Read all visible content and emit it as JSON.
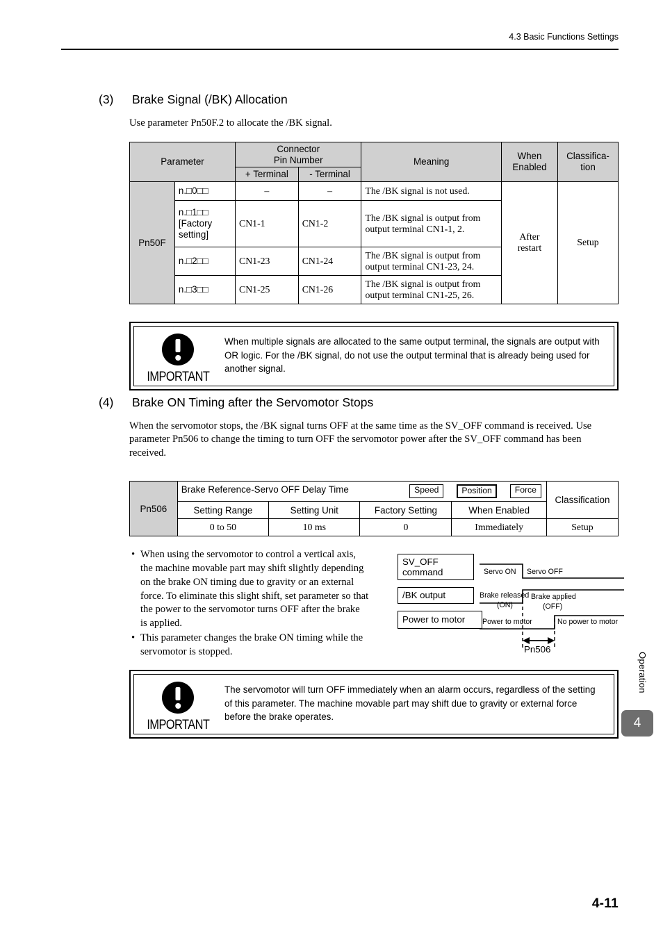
{
  "header": {
    "running_head": "4.3  Basic Functions Settings"
  },
  "section3": {
    "number": "(3)",
    "title": "Brake Signal (/BK) Allocation",
    "intro": "Use parameter Pn50F.2 to allocate the /BK signal."
  },
  "param_table": {
    "headers": {
      "parameter": "Parameter",
      "connector_pin_number": "Connector\nPin Number",
      "plus_terminal": "+ Terminal",
      "minus_terminal": "- Terminal",
      "meaning": "Meaning",
      "when_enabled": "When\nEnabled",
      "classification": "Classifica-\ntion"
    },
    "parameter_name": "Pn50F",
    "when_enabled_value": "After\nrestart",
    "classification_value": "Setup",
    "rows": [
      {
        "code": "n.□0□□",
        "note": "",
        "plus": "–",
        "minus": "–",
        "meaning": "The /BK signal is not used."
      },
      {
        "code": "n.□1□□",
        "note": "[Factory setting]",
        "plus": "CN1-1",
        "minus": "CN1-2",
        "meaning": "The /BK signal is output from output terminal CN1-1, 2."
      },
      {
        "code": "n.□2□□",
        "note": "",
        "plus": "CN1-23",
        "minus": "CN1-24",
        "meaning": "The /BK signal is output from output terminal CN1-23, 24."
      },
      {
        "code": "n.□3□□",
        "note": "",
        "plus": "CN1-25",
        "minus": "CN1-26",
        "meaning": "The /BK signal is output from output terminal CN1-25, 26."
      }
    ]
  },
  "important1": {
    "label": "IMPORTANT",
    "text": "When multiple signals are allocated to the same output terminal, the signals are output with OR logic. For the /BK signal, do not use the output terminal that is already being used for another signal."
  },
  "section4": {
    "number": "(4)",
    "title": "Brake ON Timing after the Servomotor Stops",
    "paragraph": "When the servomotor stops, the /BK signal turns OFF at the same time as the SV_OFF command is received. Use parameter Pn506 to change the timing to turn OFF the servomotor power after the SV_OFF command has been received."
  },
  "pn506_table": {
    "parameter_name": "Pn506",
    "title": "Brake Reference-Servo OFF Delay Time",
    "modes": [
      {
        "label": "Speed",
        "active": false
      },
      {
        "label": "Position",
        "active": true
      },
      {
        "label": "Force",
        "active": false
      }
    ],
    "classification_header": "Classification",
    "classification_value": "Setup",
    "columns": [
      "Setting Range",
      "Setting Unit",
      "Factory Setting",
      "When Enabled"
    ],
    "values": [
      "0 to 50",
      "10 ms",
      "0",
      "Immediately"
    ]
  },
  "bullets": [
    "When using the servomotor to control a vertical axis, the machine movable part may shift slightly depending on the brake ON timing due to gravity or an external force. To eliminate this slight shift, set parameter so that the power to the servomotor turns OFF after the brake is applied.",
    "This parameter changes the brake ON timing while the servomotor is stopped."
  ],
  "timing_diagram": {
    "signals": [
      {
        "name": "SV_OFF command",
        "left_state": "Servo ON",
        "right_state": "Servo OFF"
      },
      {
        "name": "/BK output",
        "left_state": "Brake released",
        "left_state_sub": "(ON)",
        "right_state": "Brake applied",
        "right_state_sub": "(OFF)"
      },
      {
        "name": "Power to motor",
        "left_state": "Power to motor",
        "right_state": "No power to motor"
      }
    ],
    "measure_label": "Pn506"
  },
  "important2": {
    "label": "IMPORTANT",
    "text": "The servomotor will turn OFF immediately when an alarm occurs, regardless of the setting of this parameter. The machine movable part may shift due to gravity or external force before the brake operates."
  },
  "side_tab": {
    "section_label": "Operation",
    "chapter_number": "4"
  },
  "footer": {
    "page_number": "4-11"
  }
}
